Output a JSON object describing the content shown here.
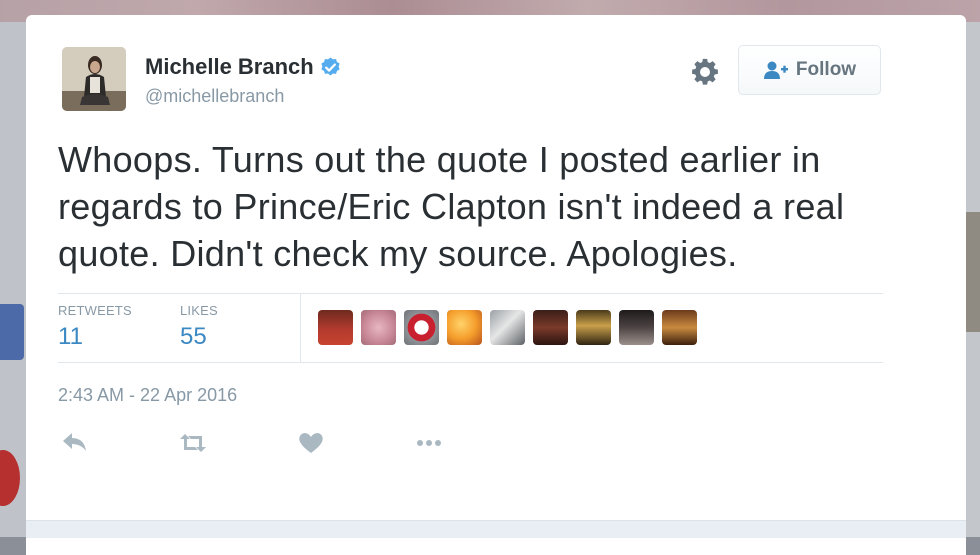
{
  "tweet": {
    "author": {
      "name": "Michelle Branch",
      "handle": "@michellebranch",
      "verified": true
    },
    "follow_label": "Follow",
    "text": "Whoops. Turns out the quote I posted earlier in regards to Prince/Eric Clapton isn't indeed a real quote. Didn't check my source. Apologies.",
    "stats": {
      "retweets_label": "RETWEETS",
      "retweets_count": "11",
      "likes_label": "LIKES",
      "likes_count": "55"
    },
    "liker_avatar_count": 9,
    "timestamp": "2:43 AM - 22 Apr 2016",
    "actions": [
      "reply-icon",
      "retweet-icon",
      "like-icon",
      "more-icon"
    ]
  },
  "colors": {
    "text": "#292f33",
    "secondary": "#8899a6",
    "link_blue": "#3b88c3",
    "verified_blue": "#55acee"
  }
}
